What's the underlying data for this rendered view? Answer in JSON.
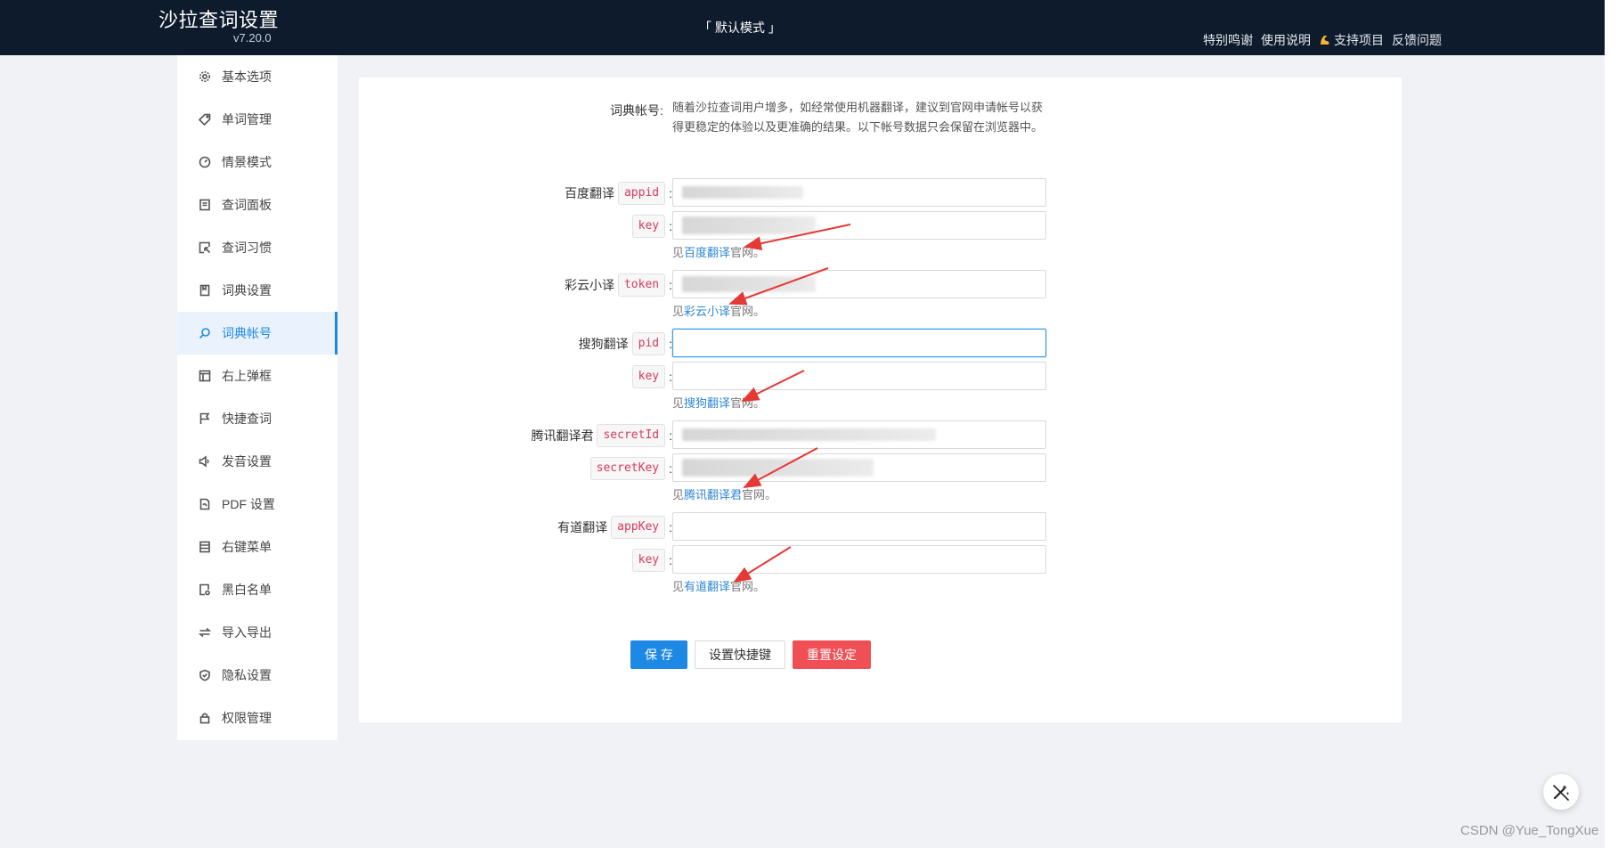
{
  "header": {
    "title": "沙拉查词设置",
    "version": "v7.20.0",
    "mode": "「 默认模式 」",
    "links": [
      "特别鸣谢",
      "使用说明",
      "支持项目",
      "反馈问题"
    ]
  },
  "sidebar": {
    "items": [
      {
        "label": "基本选项",
        "icon": "gear-icon"
      },
      {
        "label": "单词管理",
        "icon": "tag-icon"
      },
      {
        "label": "情景模式",
        "icon": "dashboard-icon"
      },
      {
        "label": "查词面板",
        "icon": "panel-icon"
      },
      {
        "label": "查词习惯",
        "icon": "select-icon"
      },
      {
        "label": "词典设置",
        "icon": "book-icon"
      },
      {
        "label": "词典帐号",
        "icon": "search-icon",
        "active": true
      },
      {
        "label": "右上弹框",
        "icon": "layout-icon"
      },
      {
        "label": "快捷查词",
        "icon": "flag-icon"
      },
      {
        "label": "发音设置",
        "icon": "sound-icon"
      },
      {
        "label": "PDF 设置",
        "icon": "pdf-icon"
      },
      {
        "label": "右键菜单",
        "icon": "menu-icon"
      },
      {
        "label": "黑白名单",
        "icon": "list-icon"
      },
      {
        "label": "导入导出",
        "icon": "swap-icon"
      },
      {
        "label": "隐私设置",
        "icon": "shield-icon"
      },
      {
        "label": "权限管理",
        "icon": "lock-icon"
      }
    ]
  },
  "main": {
    "description_label": "词典帐号:",
    "description": "随着沙拉查词用户增多，如经常使用机器翻译，建议到官网申请帐号以获得更稳定的体验以及更准确的结果。以下帐号数据只会保留在浏览器中。",
    "baidu": {
      "name": "百度翻译",
      "appid_tag": "appid",
      "key_tag": "key",
      "hint_pre": "见",
      "hint_link": "百度翻译",
      "hint_post": "官网。"
    },
    "caiyun": {
      "name": "彩云小译",
      "token_tag": "token",
      "hint_pre": "见",
      "hint_link": "彩云小译",
      "hint_post": "官网。"
    },
    "sogou": {
      "name": "搜狗翻译",
      "pid_tag": "pid",
      "key_tag": "key",
      "hint_pre": "见",
      "hint_link": "搜狗翻译",
      "hint_post": "官网。"
    },
    "tencent": {
      "name": "腾讯翻译君",
      "secretid_tag": "secretId",
      "secretkey_tag": "secretKey",
      "hint_pre": "见",
      "hint_link": "腾讯翻译君",
      "hint_post": "官网。"
    },
    "youdao": {
      "name": "有道翻译",
      "appkey_tag": "appKey",
      "key_tag": "key",
      "hint_pre": "见",
      "hint_link": "有道翻译",
      "hint_post": "官网。"
    },
    "colon": ":",
    "buttons": {
      "save": "保 存",
      "shortcut": "设置快捷键",
      "reset": "重置设定"
    }
  },
  "watermark": "CSDN @Yue_TongXue",
  "colors": {
    "accent": "#1e88e5",
    "danger": "#ef4f55",
    "header_bg": "#0d1b2d",
    "arrow": "#e53935"
  }
}
